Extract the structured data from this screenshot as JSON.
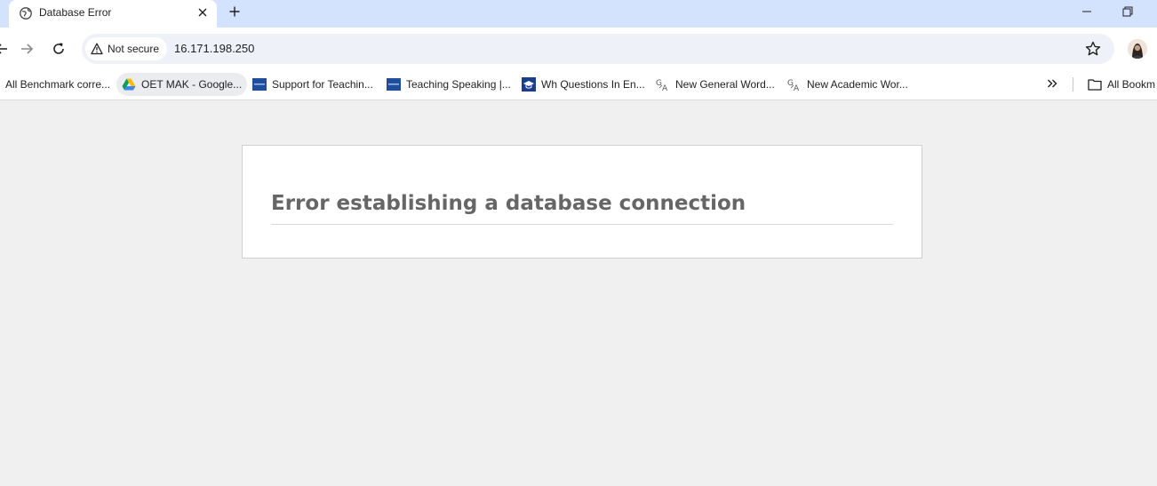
{
  "tab": {
    "title": "Database Error",
    "favicon_icon": "globe-icon"
  },
  "toolbar": {
    "security_label": "Not secure",
    "url": "16.171.198.250"
  },
  "bookmarks": [
    {
      "label": "All Benchmark corre...",
      "icon": "none"
    },
    {
      "label": "OET MAK - Google...",
      "icon": "google-drive-icon"
    },
    {
      "label": "Support for Teachin...",
      "icon": "site-favicon-blue"
    },
    {
      "label": "Teaching Speaking |...",
      "icon": "site-favicon-blue"
    },
    {
      "label": "Wh Questions In En...",
      "icon": "cap-favicon"
    },
    {
      "label": "New General Word...",
      "icon": "translate-icon"
    },
    {
      "label": "New Academic Wor...",
      "icon": "translate-icon"
    }
  ],
  "bookmarks_folder": {
    "label": "All Bookm"
  },
  "page": {
    "error_message": "Error establishing a database connection"
  },
  "colors": {
    "tabstrip_bg": "#d3e3fd",
    "page_bg": "#f0f0f0",
    "error_text": "#666666"
  }
}
